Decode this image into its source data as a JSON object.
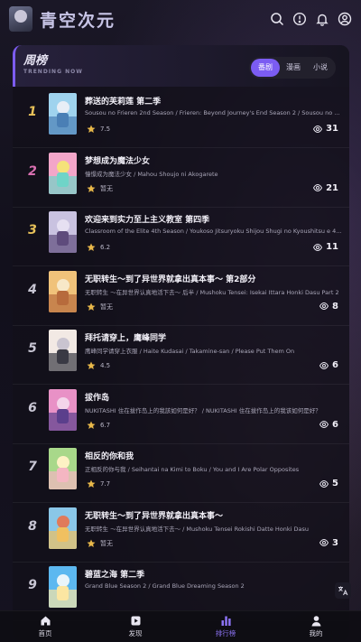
{
  "app": {
    "title": "青空次元"
  },
  "header_icons": [
    "search-icon",
    "history-icon",
    "bell-icon",
    "user-icon"
  ],
  "panel": {
    "title": "周榜",
    "subtitle": "TRENDING NOW",
    "tabs": [
      {
        "label": "番剧",
        "active": true
      },
      {
        "label": "漫画",
        "active": false
      },
      {
        "label": "小说",
        "active": false
      }
    ]
  },
  "colors": {
    "accent": "#7b5cf2",
    "rank_gold": "#e8c25a",
    "rank_pink": "#d86fb0",
    "star": "#e8b84a"
  },
  "ranking": [
    {
      "rank": "1",
      "title": "葬送的芙莉莲 第二季",
      "alt": "Sousou no Frieren 2nd Season / Frieren: Beyond Journey's End Season 2 / Sousou no Frieren Season 2",
      "score": "7.5",
      "views": "31"
    },
    {
      "rank": "2",
      "title": "梦想成为魔法少女",
      "alt": "憧憬成为魔法少女 / Mahou Shoujo ni Akogarete",
      "score": "暂无",
      "views": "21"
    },
    {
      "rank": "3",
      "title": "欢迎来到实力至上主义教室 第四季",
      "alt": "Classroom of the Elite 4th Season / Youkoso Jitsuryoku Shijou Shugi no Kyoushitsu e 4th Season",
      "score": "6.2",
      "views": "11"
    },
    {
      "rank": "4",
      "title": "无职转生～到了异世界就拿出真本事～ 第2部分",
      "alt": "无职转生 ～在异世界认真地活下去～ 后半 / Mushoku Tensei: Isekai Ittara Honki Dasu Part 2",
      "score": "暂无",
      "views": "8"
    },
    {
      "rank": "5",
      "title": "拜托请穿上，鹰峰同学",
      "alt": "鹰峰同学请穿上衣服 / Haite Kudasai / Takamine-san / Please Put Them On",
      "score": "4.5",
      "views": "6"
    },
    {
      "rank": "6",
      "title": "拔作岛",
      "alt": "NUKITASHI 住在拔作岛上的我該如何是好？ / NUKITASHI 住在拔作岛上的我该如何是好？",
      "score": "6.7",
      "views": "6"
    },
    {
      "rank": "7",
      "title": "相反的你和我",
      "alt": "正相反的你与我 / Seihantai na Kimi to Boku / You and I Are Polar Opposites",
      "score": "7.7",
      "views": "5"
    },
    {
      "rank": "8",
      "title": "无职转生～到了异世界就拿出真本事～",
      "alt": "无职转生 ～在异世界认真地活下去～ / Mushoku Tensei Rokishi Datte Honki Dasu",
      "score": "暂无",
      "views": "3"
    },
    {
      "rank": "9",
      "title": "碧蓝之海 第二季",
      "alt": "Grand Blue Season 2 / Grand Blue Dreaming Season 2",
      "score": "",
      "views": ""
    }
  ],
  "bottom_nav": [
    {
      "label": "首页",
      "icon": "home-icon",
      "active": false
    },
    {
      "label": "发现",
      "icon": "discover-icon",
      "active": false
    },
    {
      "label": "排行榜",
      "icon": "ranking-icon",
      "active": true
    },
    {
      "label": "我的",
      "icon": "profile-icon",
      "active": false
    }
  ],
  "translate_button": {
    "icon": "translate-icon"
  }
}
